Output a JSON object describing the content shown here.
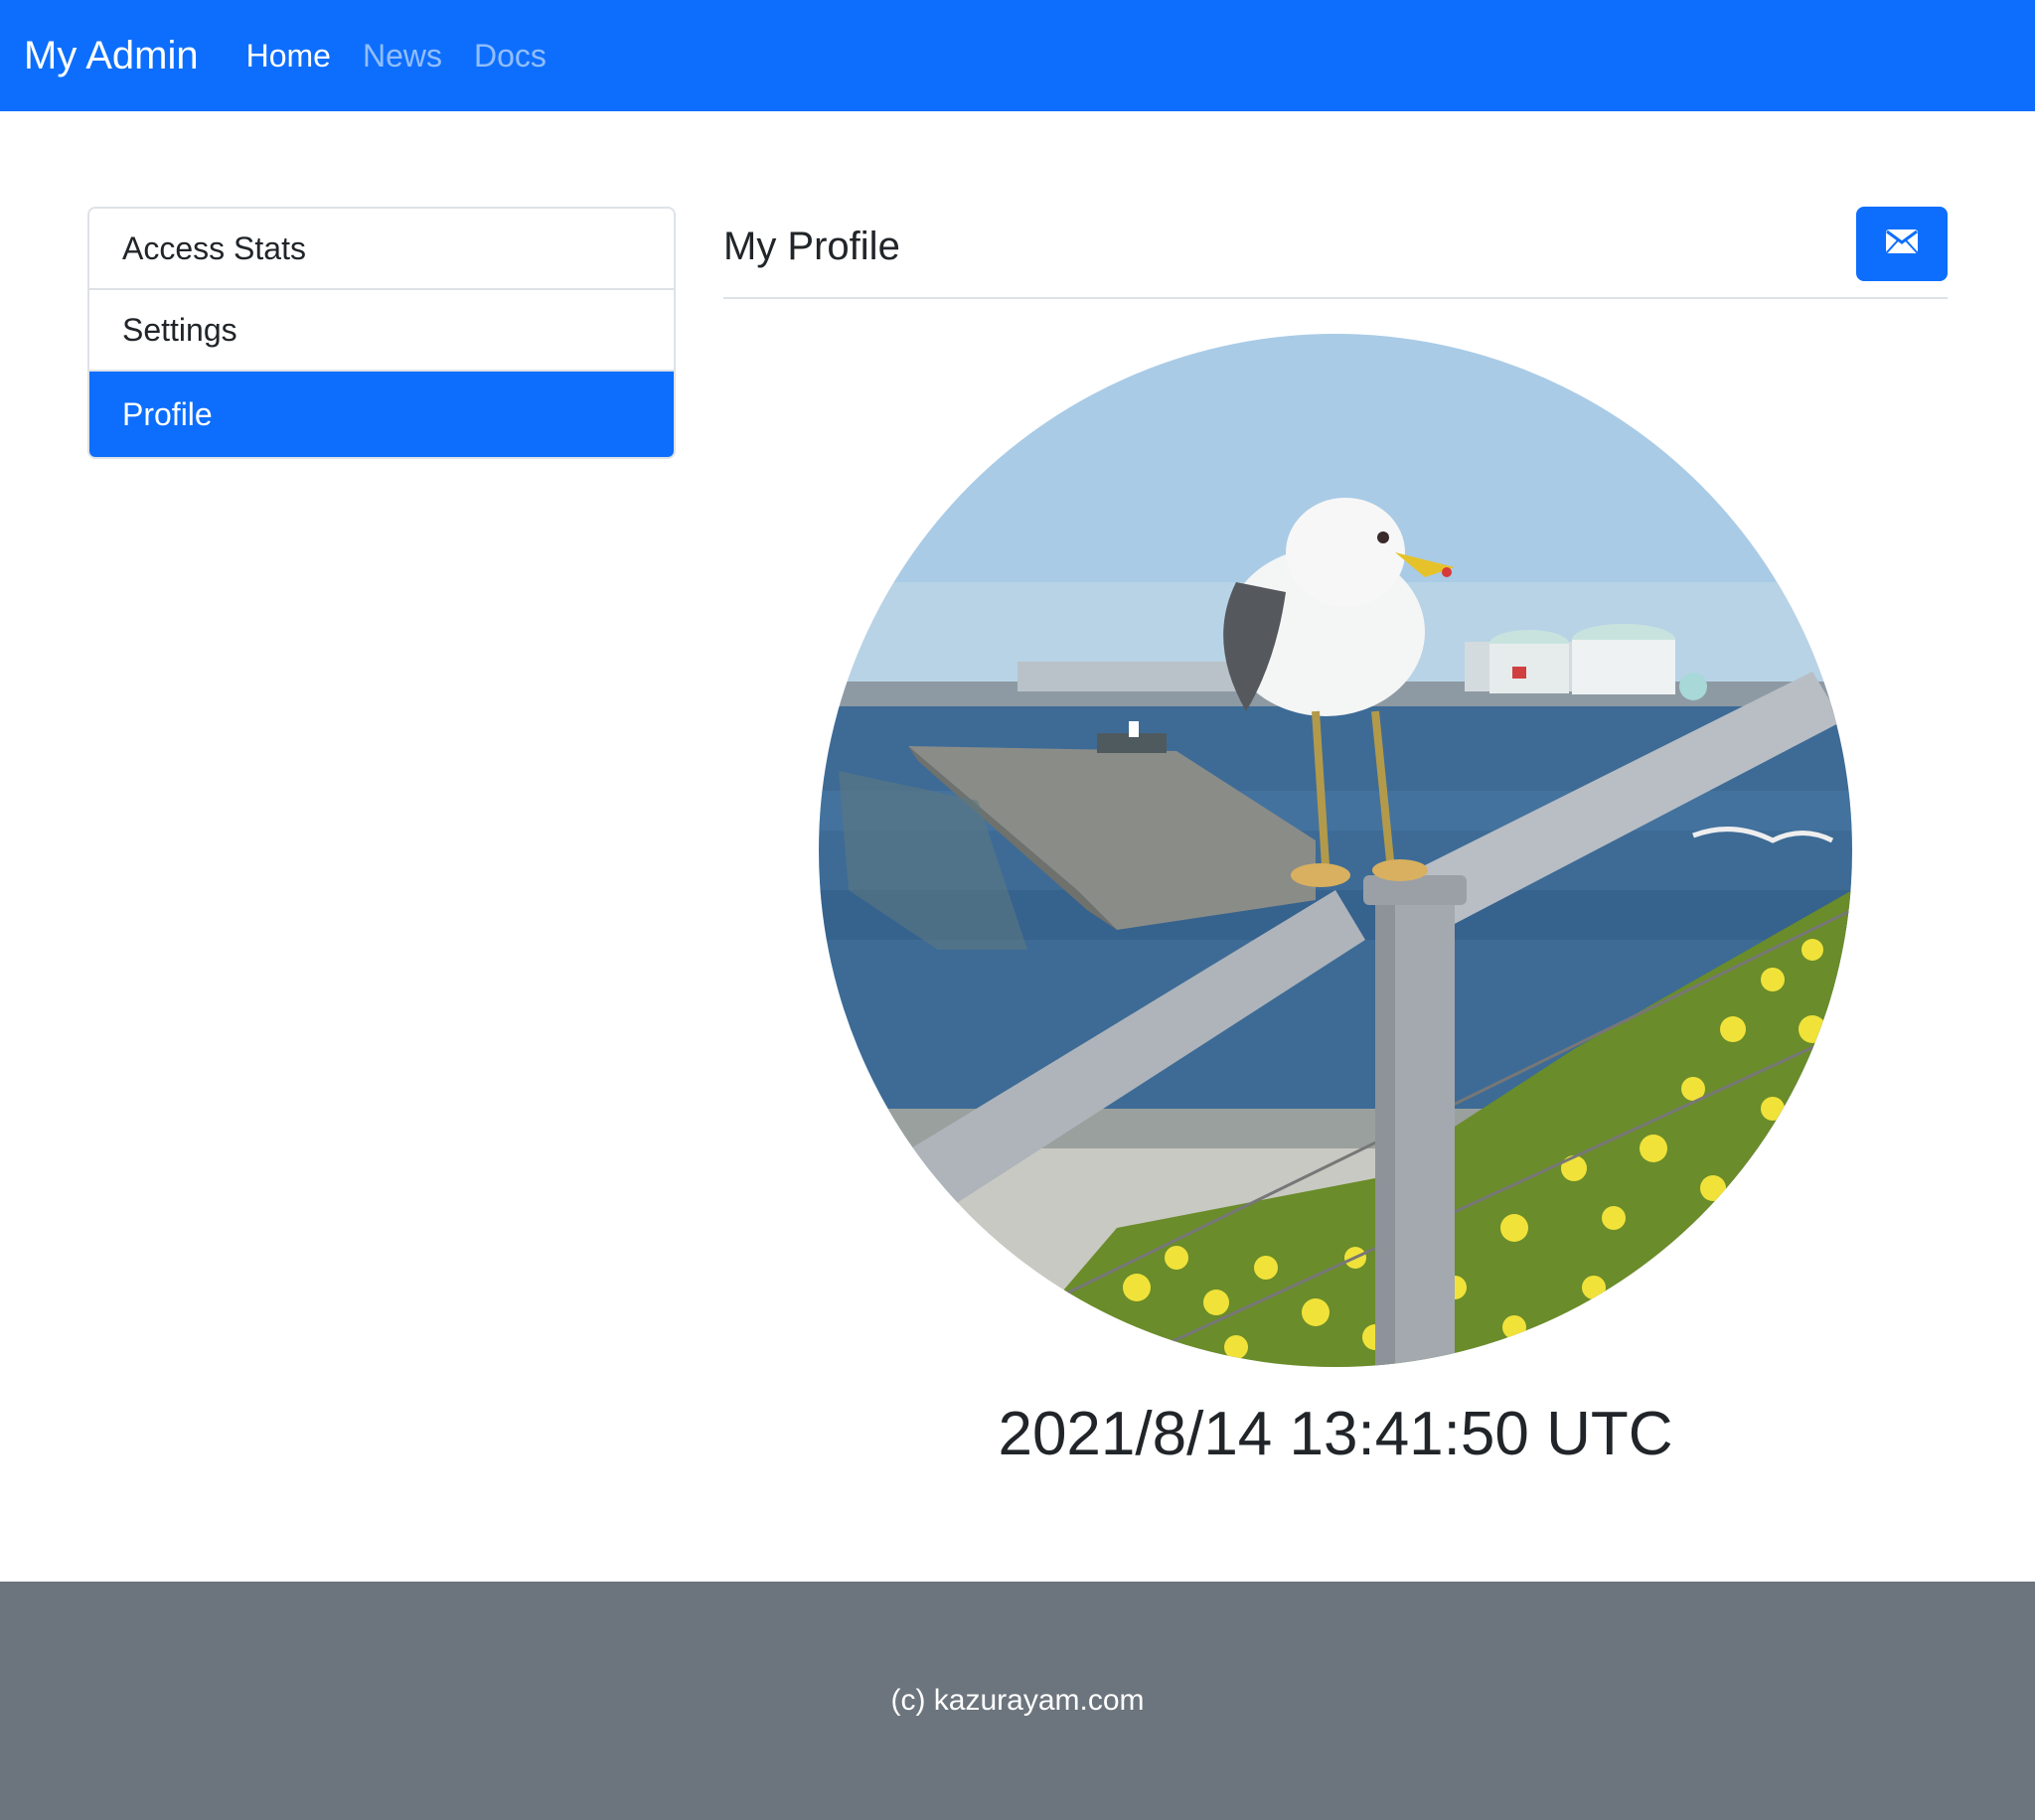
{
  "navbar": {
    "brand": "My Admin",
    "links": [
      {
        "label": "Home",
        "active": true
      },
      {
        "label": "News",
        "active": false
      },
      {
        "label": "Docs",
        "active": false
      }
    ],
    "background_color": "#0d6efd"
  },
  "sidebar": {
    "items": [
      {
        "label": "Access Stats",
        "active": false
      },
      {
        "label": "Settings",
        "active": false
      },
      {
        "label": "Profile",
        "active": true
      }
    ],
    "active_color": "#0d6efd"
  },
  "main": {
    "title": "My Profile",
    "mail_button_icon": "envelope-icon",
    "timestamp": "2021/8/14 13:41:50 UTC"
  },
  "footer": {
    "text": "(c) kazurayam.com",
    "background_color": "#6c757d"
  }
}
